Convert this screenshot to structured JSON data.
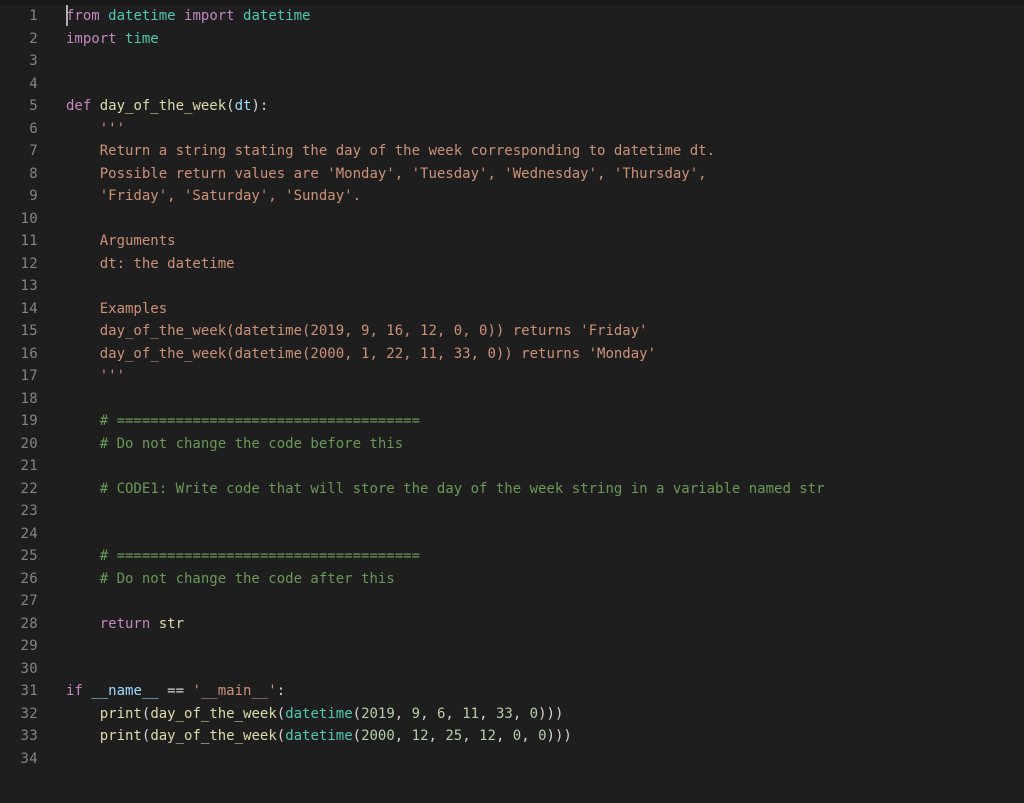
{
  "colors": {
    "background": "#1e1e1e",
    "gutter_fg": "#858585",
    "keyword": "#c586c0",
    "class": "#4ec9b0",
    "function": "#dcdcaa",
    "variable": "#9cdcfe",
    "string": "#ce9178",
    "comment": "#6a9955",
    "number": "#b5cea8",
    "default": "#d4d4d4"
  },
  "line_numbers": [
    "1",
    "2",
    "3",
    "4",
    "5",
    "6",
    "7",
    "8",
    "9",
    "10",
    "11",
    "12",
    "13",
    "14",
    "15",
    "16",
    "17",
    "18",
    "19",
    "20",
    "21",
    "22",
    "23",
    "24",
    "25",
    "26",
    "27",
    "28",
    "29",
    "30",
    "31",
    "32",
    "33",
    "34"
  ],
  "lines": [
    [
      [
        "kw",
        "from"
      ],
      [
        "op",
        " "
      ],
      [
        "mod",
        "datetime"
      ],
      [
        "op",
        " "
      ],
      [
        "kw",
        "import"
      ],
      [
        "op",
        " "
      ],
      [
        "mod",
        "datetime"
      ]
    ],
    [
      [
        "kw",
        "import"
      ],
      [
        "op",
        " "
      ],
      [
        "mod",
        "time"
      ]
    ],
    [],
    [],
    [
      [
        "kw",
        "def"
      ],
      [
        "op",
        " "
      ],
      [
        "fn",
        "day_of_the_week"
      ],
      [
        "op",
        "("
      ],
      [
        "var",
        "dt"
      ],
      [
        "op",
        "):"
      ]
    ],
    [
      [
        "op",
        "    "
      ],
      [
        "str",
        "'''"
      ]
    ],
    [
      [
        "op",
        "    "
      ],
      [
        "str",
        "Return a string stating the day of the week corresponding to datetime dt."
      ]
    ],
    [
      [
        "op",
        "    "
      ],
      [
        "str",
        "Possible return values are 'Monday', 'Tuesday', 'Wednesday', 'Thursday',"
      ]
    ],
    [
      [
        "op",
        "    "
      ],
      [
        "str",
        "'Friday', 'Saturday', 'Sunday'."
      ]
    ],
    [],
    [
      [
        "op",
        "    "
      ],
      [
        "str",
        "Arguments"
      ]
    ],
    [
      [
        "op",
        "    "
      ],
      [
        "str",
        "dt: the datetime"
      ]
    ],
    [],
    [
      [
        "op",
        "    "
      ],
      [
        "str",
        "Examples"
      ]
    ],
    [
      [
        "op",
        "    "
      ],
      [
        "str",
        "day_of_the_week(datetime(2019, 9, 16, 12, 0, 0)) returns 'Friday'"
      ]
    ],
    [
      [
        "op",
        "    "
      ],
      [
        "str",
        "day_of_the_week(datetime(2000, 1, 22, 11, 33, 0)) returns 'Monday'"
      ]
    ],
    [
      [
        "op",
        "    "
      ],
      [
        "str",
        "'''"
      ]
    ],
    [],
    [
      [
        "op",
        "    "
      ],
      [
        "cmt",
        "# ===================================="
      ]
    ],
    [
      [
        "op",
        "    "
      ],
      [
        "cmt",
        "# Do not change the code before this"
      ]
    ],
    [],
    [
      [
        "op",
        "    "
      ],
      [
        "cmt",
        "# CODE1: Write code that will store the day of the week string in a variable named str"
      ]
    ],
    [],
    [],
    [
      [
        "op",
        "    "
      ],
      [
        "cmt",
        "# ===================================="
      ]
    ],
    [
      [
        "op",
        "    "
      ],
      [
        "cmt",
        "# Do not change the code after this"
      ]
    ],
    [],
    [
      [
        "op",
        "    "
      ],
      [
        "kw",
        "return"
      ],
      [
        "op",
        " "
      ],
      [
        "builtin",
        "str"
      ]
    ],
    [],
    [],
    [
      [
        "kw",
        "if"
      ],
      [
        "op",
        " "
      ],
      [
        "dund",
        "__name__"
      ],
      [
        "op",
        " == "
      ],
      [
        "str",
        "'__main__'"
      ],
      [
        "op",
        ":"
      ]
    ],
    [
      [
        "op",
        "    "
      ],
      [
        "builtin",
        "print"
      ],
      [
        "op",
        "("
      ],
      [
        "fn",
        "day_of_the_week"
      ],
      [
        "op",
        "("
      ],
      [
        "mod",
        "datetime"
      ],
      [
        "op",
        "("
      ],
      [
        "num",
        "2019"
      ],
      [
        "op",
        ", "
      ],
      [
        "num",
        "9"
      ],
      [
        "op",
        ", "
      ],
      [
        "num",
        "6"
      ],
      [
        "op",
        ", "
      ],
      [
        "num",
        "11"
      ],
      [
        "op",
        ", "
      ],
      [
        "num",
        "33"
      ],
      [
        "op",
        ", "
      ],
      [
        "num",
        "0"
      ],
      [
        "op",
        ")))"
      ]
    ],
    [
      [
        "op",
        "    "
      ],
      [
        "builtin",
        "print"
      ],
      [
        "op",
        "("
      ],
      [
        "fn",
        "day_of_the_week"
      ],
      [
        "op",
        "("
      ],
      [
        "mod",
        "datetime"
      ],
      [
        "op",
        "("
      ],
      [
        "num",
        "2000"
      ],
      [
        "op",
        ", "
      ],
      [
        "num",
        "12"
      ],
      [
        "op",
        ", "
      ],
      [
        "num",
        "25"
      ],
      [
        "op",
        ", "
      ],
      [
        "num",
        "12"
      ],
      [
        "op",
        ", "
      ],
      [
        "num",
        "0"
      ],
      [
        "op",
        ", "
      ],
      [
        "num",
        "0"
      ],
      [
        "op",
        ")))"
      ]
    ],
    []
  ],
  "plain_source": "from datetime import datetime\nimport time\n\n\ndef day_of_the_week(dt):\n    '''\n    Return a string stating the day of the week corresponding to datetime dt.\n    Possible return values are 'Monday', 'Tuesday', 'Wednesday', 'Thursday',\n    'Friday', 'Saturday', 'Sunday'.\n\n    Arguments\n    dt: the datetime\n\n    Examples\n    day_of_the_week(datetime(2019, 9, 16, 12, 0, 0)) returns 'Friday'\n    day_of_the_week(datetime(2000, 1, 22, 11, 33, 0)) returns 'Monday'\n    '''\n\n    # ====================================\n    # Do not change the code before this\n\n    # CODE1: Write code that will store the day of the week string in a variable named str\n\n\n    # ====================================\n    # Do not change the code after this\n\n    return str\n\n\nif __name__ == '__main__':\n    print(day_of_the_week(datetime(2019, 9, 6, 11, 33, 0)))\n    print(day_of_the_week(datetime(2000, 12, 25, 12, 0, 0)))\n"
}
